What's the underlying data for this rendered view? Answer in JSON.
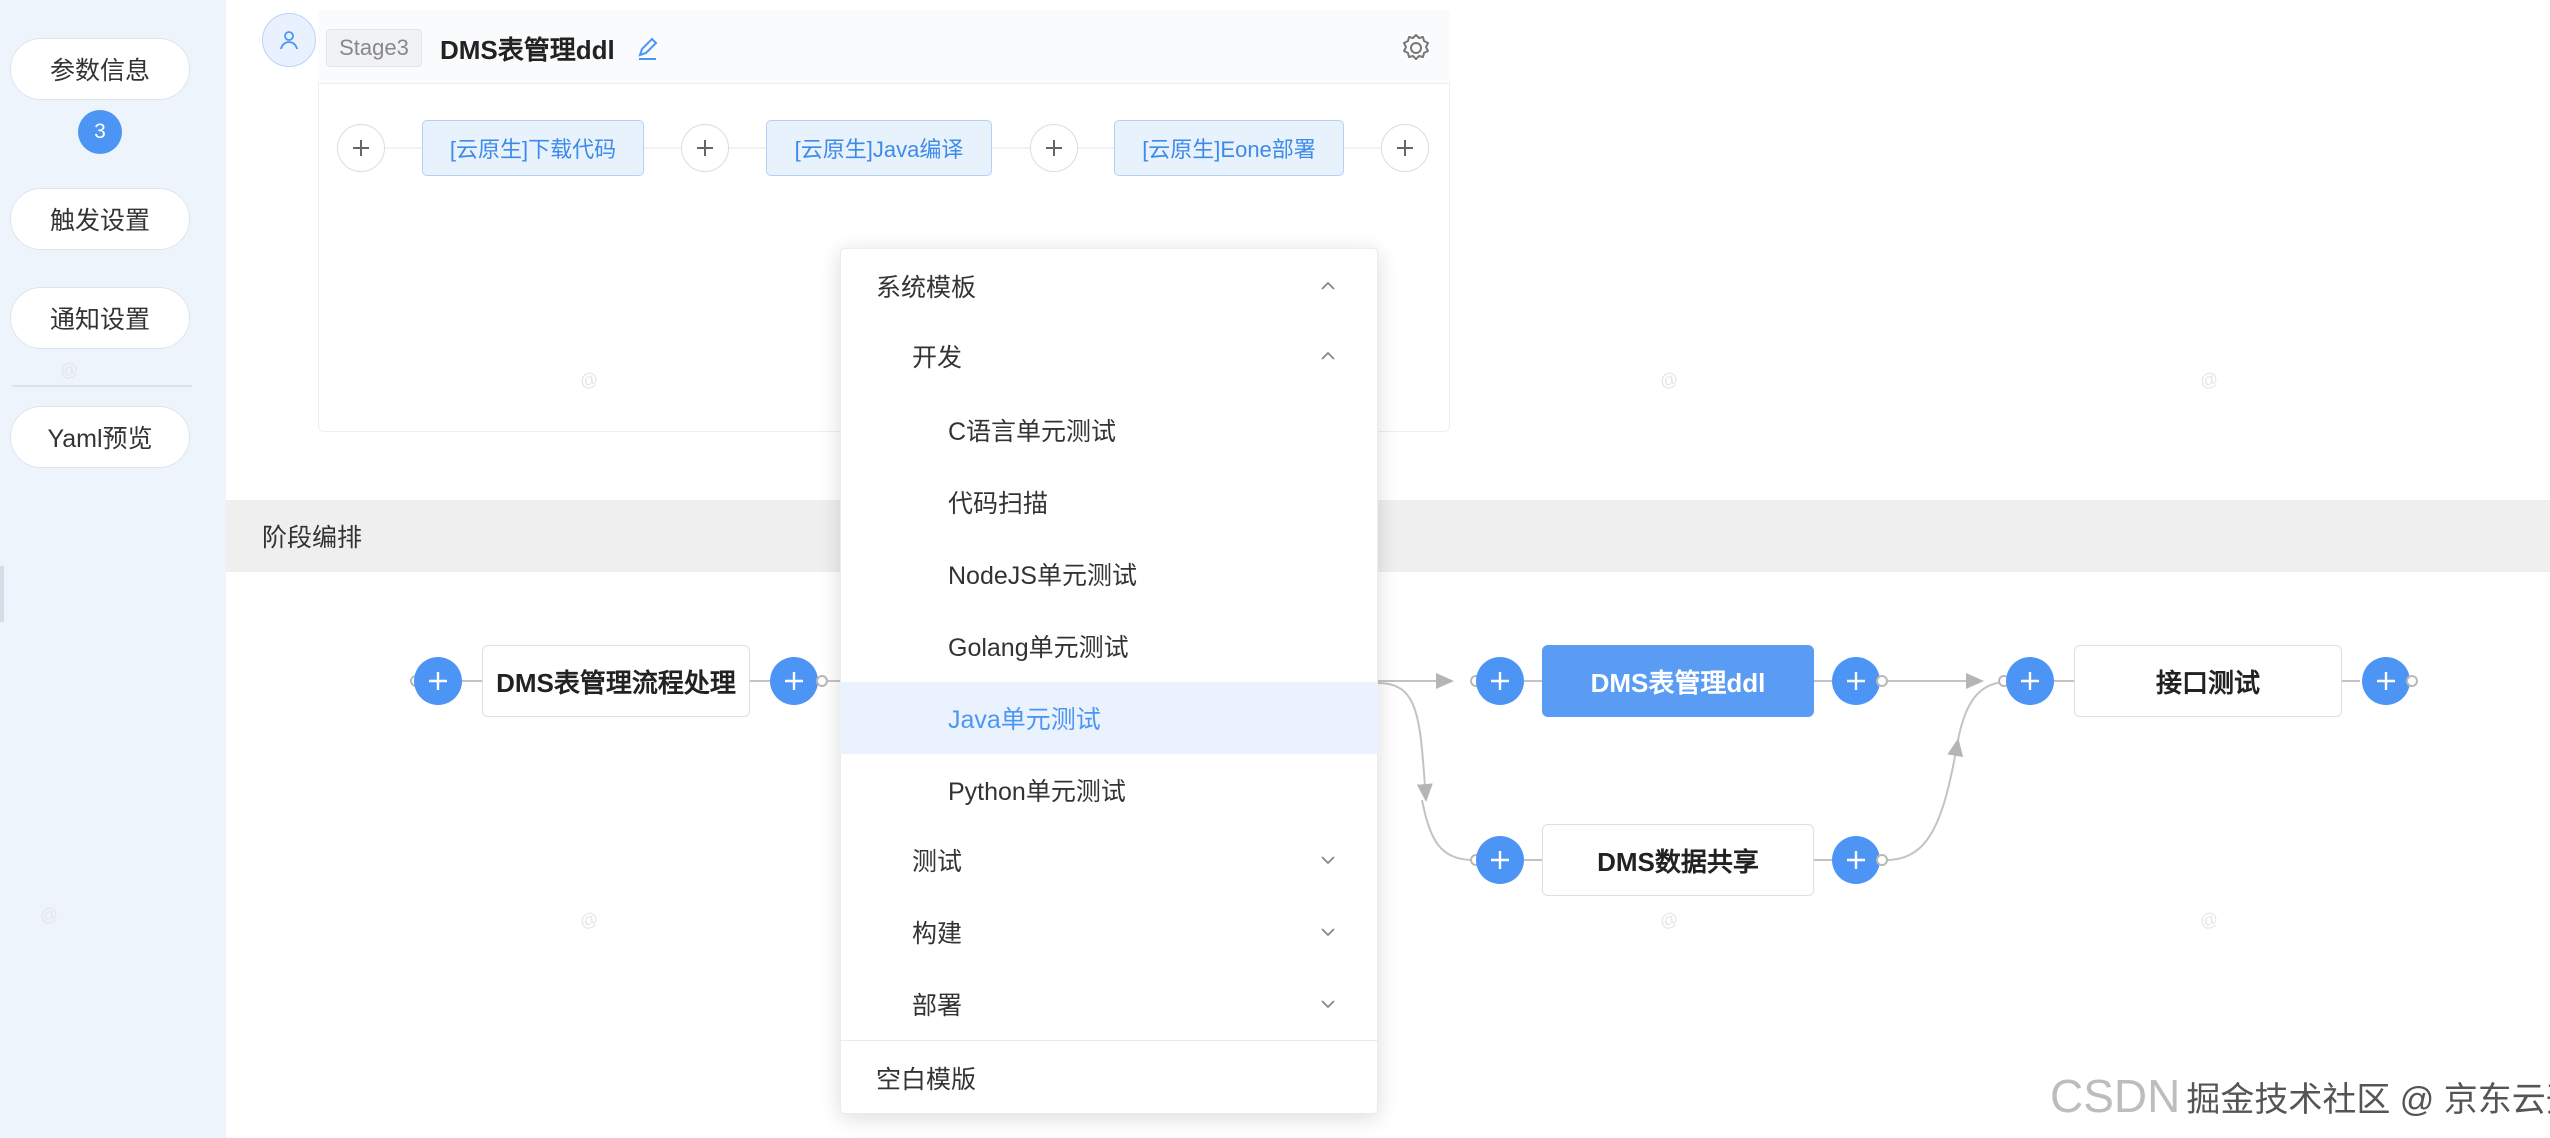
{
  "sidebar": {
    "items": [
      {
        "label": "参数信息"
      },
      {
        "label": "触发设置"
      },
      {
        "label": "通知设置"
      },
      {
        "label": "Yaml预览"
      }
    ],
    "step_badge": "3"
  },
  "stage": {
    "tag": "Stage3",
    "title": "DMS表管理ddl",
    "tasks": [
      {
        "label": "[云原生]下载代码"
      },
      {
        "label": "[云原生]Java编译"
      },
      {
        "label": "[云原生]Eone部署"
      }
    ]
  },
  "section": {
    "title": "阶段编排"
  },
  "flow": {
    "nodes": [
      {
        "label": "DMS表管理流程处理"
      },
      {
        "label": "DMS表管理ddl",
        "active": true
      },
      {
        "label": "DMS数据共享"
      },
      {
        "label": "接口测试"
      }
    ]
  },
  "dropdown": {
    "items": [
      {
        "label": "系统模板",
        "level": 1,
        "expanded": true
      },
      {
        "label": "开发",
        "level": 2,
        "expanded": true
      },
      {
        "label": "C语言单元测试",
        "level": 3
      },
      {
        "label": "代码扫描",
        "level": 3
      },
      {
        "label": "NodeJS单元测试",
        "level": 3
      },
      {
        "label": "Golang单元测试",
        "level": 3
      },
      {
        "label": "Java单元测试",
        "level": 3,
        "selected": true
      },
      {
        "label": "Python单元测试",
        "level": 3
      },
      {
        "label": "测试",
        "level": 2,
        "expanded": false
      },
      {
        "label": "构建",
        "level": 2,
        "expanded": false
      },
      {
        "label": "部署",
        "level": 2,
        "expanded": false
      },
      {
        "label": "空白模版",
        "level": 1
      }
    ]
  },
  "watermark": {
    "main": "CSDN",
    "overlay": "掘金技术社区 @ 京东云开发者"
  },
  "colors": {
    "accent": "#4d95f5",
    "sidebar_bg": "#eef4fc",
    "selected_bg": "#eaf3fd"
  }
}
